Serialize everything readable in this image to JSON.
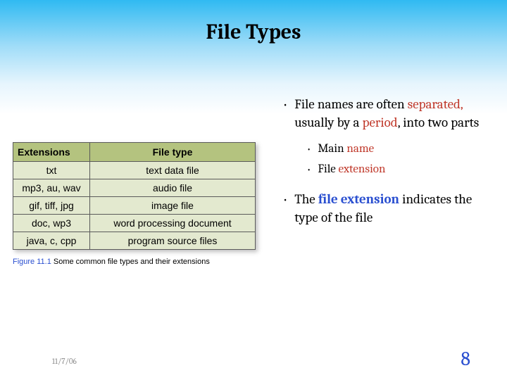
{
  "title": "File Types",
  "table": {
    "headers": {
      "ext": "Extensions",
      "type": "File type"
    },
    "rows": [
      {
        "ext": "txt",
        "type": "text data file"
      },
      {
        "ext": "mp3, au, wav",
        "type": "audio file"
      },
      {
        "ext": "gif, tiff, jpg",
        "type": "image file"
      },
      {
        "ext": "doc, wp3",
        "type": "word processing document"
      },
      {
        "ext": "java, c, cpp",
        "type": "program source files"
      }
    ]
  },
  "caption": {
    "label": "Figure 11.1",
    "text": "Some common file types and their extensions"
  },
  "bullets": {
    "b1_pre": "File names are often ",
    "b1_sep": "separated,",
    "b1_mid": " usually by a ",
    "b1_per": "period",
    "b1_post": ", into two parts",
    "sub1_pre": "Main ",
    "sub1_hl": "name",
    "sub2_pre": "File ",
    "sub2_hl": "extension",
    "b2_pre": "The ",
    "b2_hl": "file extension",
    "b2_post": " indicates the type of the file"
  },
  "footer": {
    "date": "11/7/06",
    "page": "8"
  }
}
